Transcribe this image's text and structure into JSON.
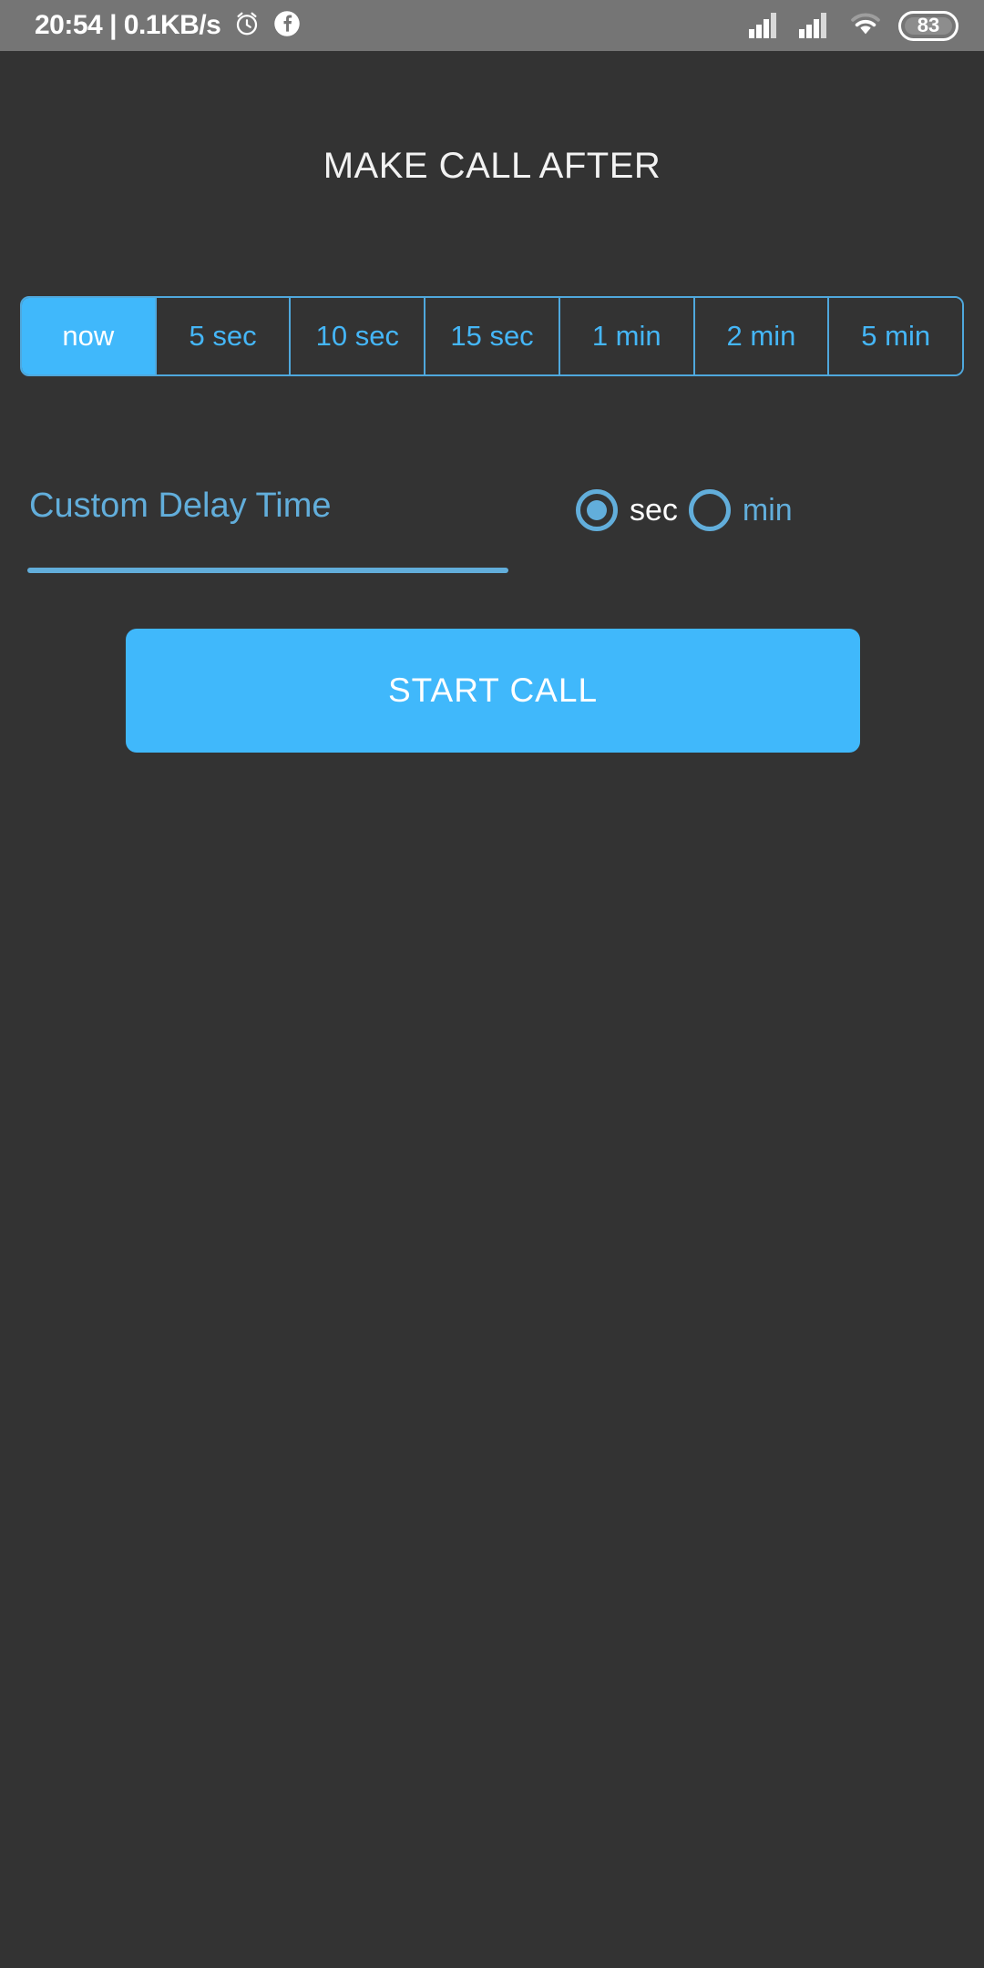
{
  "status_bar": {
    "clock": "20:54 | 0.1KB/s",
    "alarm_icon": "alarm-clock-icon",
    "app_icon": "facebook-icon",
    "signal_icon_1": "signal-bars-icon",
    "signal_icon_2": "signal-bars-icon",
    "wifi_icon": "wifi-icon",
    "battery_level": "83"
  },
  "screen": {
    "title": "MAKE CALL AFTER"
  },
  "delay_presets": {
    "options": [
      {
        "label": "now",
        "selected": true
      },
      {
        "label": "5 sec",
        "selected": false
      },
      {
        "label": "10 sec",
        "selected": false
      },
      {
        "label": "15 sec",
        "selected": false
      },
      {
        "label": "1 min",
        "selected": false
      },
      {
        "label": "2 min",
        "selected": false
      },
      {
        "label": "5 min",
        "selected": false
      }
    ]
  },
  "custom_delay": {
    "placeholder": "Custom Delay Time",
    "value": "",
    "units": [
      {
        "label": "sec",
        "selected": true
      },
      {
        "label": "min",
        "selected": false
      }
    ]
  },
  "actions": {
    "start_call_label": "START CALL"
  },
  "colors": {
    "accent": "#40b8fb",
    "accent_muted": "#62aedb",
    "background": "#333333",
    "status_bar": "#757575",
    "text_primary": "#f2f2f2"
  }
}
